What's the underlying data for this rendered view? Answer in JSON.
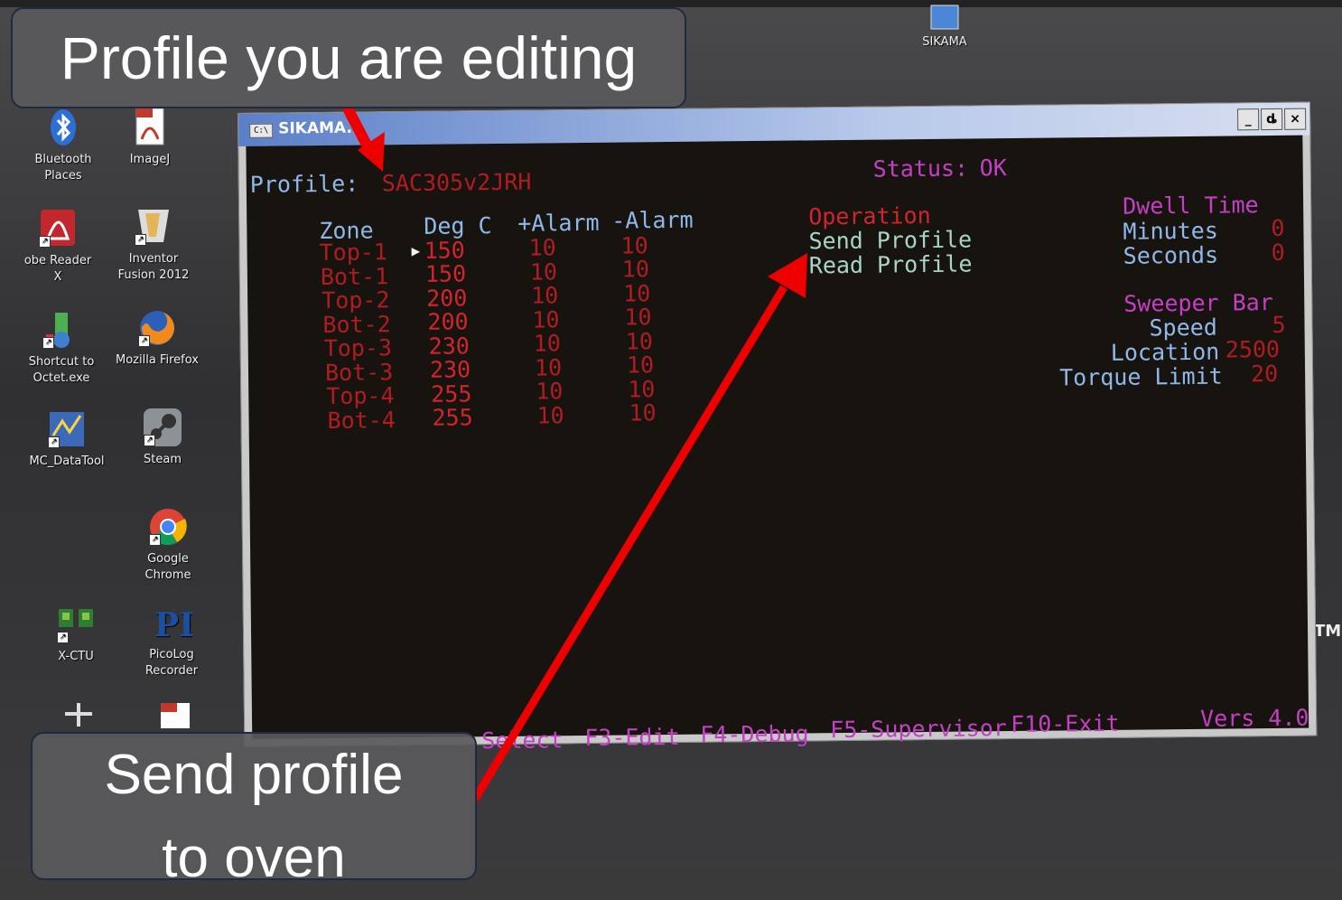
{
  "desktop": {
    "icons": [
      {
        "label": "Bluetooth\nPlaces",
        "icon": "bluetooth-icon"
      },
      {
        "label": "ImageJ",
        "icon": "pdf-icon"
      },
      {
        "label": "obe Reader\nX",
        "icon": "acrobat-icon"
      },
      {
        "label": "Inventor\nFusion 2012",
        "icon": "inventor-icon"
      },
      {
        "label": "Shortcut to\nOctet.exe",
        "icon": "octet-icon"
      },
      {
        "label": "Mozilla Firefox",
        "icon": "firefox-icon"
      },
      {
        "label": "MC_DataTool",
        "icon": "datatool-icon"
      },
      {
        "label": "Steam",
        "icon": "steam-icon"
      },
      {
        "label": "Google\nChrome",
        "icon": "chrome-icon"
      },
      {
        "label": "X-CTU",
        "icon": "xctu-icon"
      },
      {
        "label": "PicoLog\nRecorder",
        "icon": "picolog-icon"
      },
      {
        "label": "SIKAMA",
        "icon": "sikama-desktop-icon"
      }
    ],
    "trademark": "TM"
  },
  "window": {
    "title": "SIKAMA...",
    "app_icon_text": "C:\\",
    "buttons": {
      "minimize": "_",
      "restore": "ȡ",
      "close": "×"
    }
  },
  "console": {
    "profile_label": "Profile:",
    "profile_name": "SAC305v2JRH",
    "status_label": "Status:",
    "status_value": "OK",
    "table": {
      "headers": [
        "Zone",
        "Deg C",
        "+Alarm",
        "-Alarm"
      ],
      "rows": [
        {
          "zone": "Top-1",
          "deg": "150",
          "plus": "10",
          "minus": "10"
        },
        {
          "zone": "Bot-1",
          "deg": "150",
          "plus": "10",
          "minus": "10"
        },
        {
          "zone": "Top-2",
          "deg": "200",
          "plus": "10",
          "minus": "10"
        },
        {
          "zone": "Bot-2",
          "deg": "200",
          "plus": "10",
          "minus": "10"
        },
        {
          "zone": "Top-3",
          "deg": "230",
          "plus": "10",
          "minus": "10"
        },
        {
          "zone": "Bot-3",
          "deg": "230",
          "plus": "10",
          "minus": "10"
        },
        {
          "zone": "Top-4",
          "deg": "255",
          "plus": "10",
          "minus": "10"
        },
        {
          "zone": "Bot-4",
          "deg": "255",
          "plus": "10",
          "minus": "10"
        }
      ],
      "cursor": "▶"
    },
    "operation": {
      "heading": "Operation",
      "items": [
        "Send Profile",
        "Read Profile"
      ]
    },
    "dwell": {
      "heading": "Dwell Time",
      "minutes_label": "Minutes",
      "minutes_value": "0",
      "seconds_label": "Seconds",
      "seconds_value": "0"
    },
    "sweeper": {
      "heading": "Sweeper Bar",
      "speed_label": "Speed",
      "speed_value": "5",
      "location_label": "Location",
      "location_value": "2500",
      "torque_label": "Torque Limit",
      "torque_value": "20"
    },
    "footer": {
      "select": "Select",
      "edit": "F3-Edit",
      "debug": "F4-Debug",
      "supervisor": "F5-Supervisor",
      "exit": "F10-Exit",
      "version": "Vers 4.0"
    }
  },
  "callouts": {
    "top": "Profile you are editing",
    "bottom_line1": "Send profile",
    "bottom_line2": "to oven"
  },
  "colors": {
    "console_bg": "#171410",
    "header_blue": "#8fb8e8",
    "value_red": "#d2242c",
    "heading_magenta": "#c43fc4",
    "arrow_red": "#ee0000"
  }
}
